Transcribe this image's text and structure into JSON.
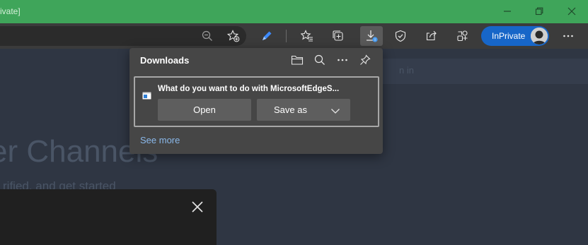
{
  "window": {
    "title_fragment": "ivate]",
    "controls": [
      "minimize-icon",
      "restore-icon",
      "close-icon"
    ]
  },
  "toolbar": {
    "icons": [
      "zoom-out-icon",
      "add-favorite-icon",
      "copilot-pen-icon",
      "favorites-icon",
      "collections-icon",
      "downloads-icon",
      "browser-essentials-icon",
      "share-icon",
      "extensions-icon",
      "more-icon"
    ],
    "inprivate_label": "InPrivate"
  },
  "downloads": {
    "title": "Downloads",
    "header_icons": [
      "folder-icon",
      "search-icon",
      "more-icon",
      "pin-icon"
    ],
    "item": {
      "prompt": "What do you want to do with MicrosoftEdgeS...",
      "open_label": "Open",
      "save_as_label": "Save as"
    },
    "see_more": "See more"
  },
  "background_page": {
    "heading_fragment": "er Channels",
    "subtext_fragment": "rified, and get started",
    "banner_fragment": "n in"
  },
  "colors": {
    "titlebar": "#3fa55a",
    "toolbar": "#3b3b3b",
    "flyout": "#464646",
    "button": "#5e5e5e",
    "inprivate": "#1766c8",
    "link": "#8ab8ea"
  }
}
